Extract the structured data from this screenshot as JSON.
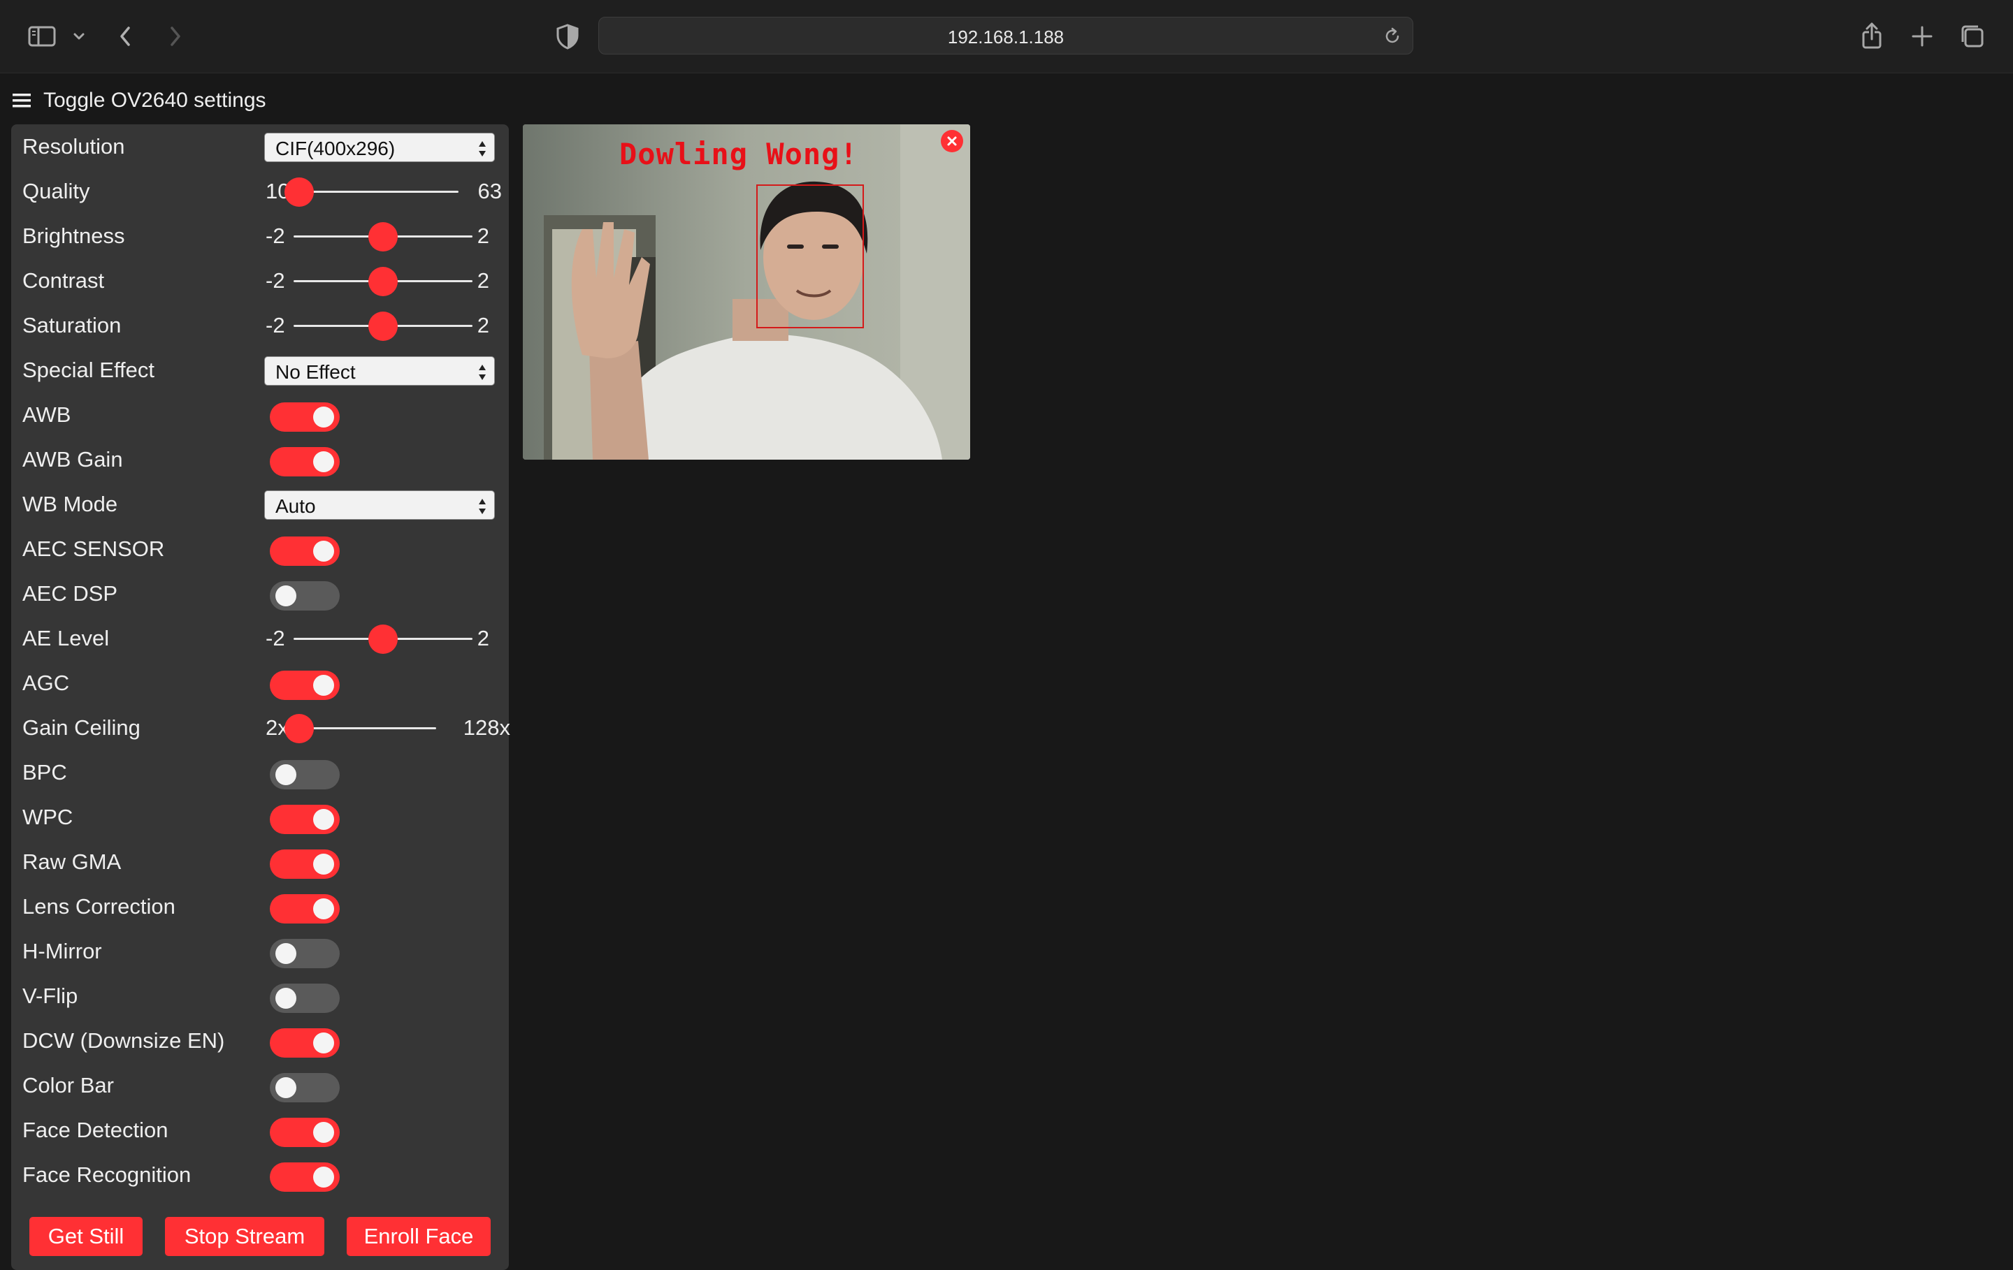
{
  "browser": {
    "url": "192.168.1.188",
    "icons": {
      "sidebar": "sidebar-icon",
      "back": "chevron-left-icon",
      "forward": "chevron-right-icon",
      "privacy": "shield-icon",
      "reload": "reload-icon",
      "share": "share-icon",
      "new_tab": "plus-icon",
      "tabs": "tab-overview-icon"
    }
  },
  "menu": {
    "toggle_label": "Toggle OV2640 settings"
  },
  "settings": {
    "resolution": {
      "label": "Resolution",
      "value": "CIF(400x296)"
    },
    "quality": {
      "label": "Quality",
      "min": "10",
      "max": "63",
      "value": 10
    },
    "brightness": {
      "label": "Brightness",
      "min": "-2",
      "max": "2",
      "value": 0
    },
    "contrast": {
      "label": "Contrast",
      "min": "-2",
      "max": "2",
      "value": 0
    },
    "saturation": {
      "label": "Saturation",
      "min": "-2",
      "max": "2",
      "value": 0
    },
    "special_effect": {
      "label": "Special Effect",
      "value": "No Effect"
    },
    "awb": {
      "label": "AWB",
      "on": true
    },
    "awb_gain": {
      "label": "AWB Gain",
      "on": true
    },
    "wb_mode": {
      "label": "WB Mode",
      "value": "Auto"
    },
    "aec_sensor": {
      "label": "AEC SENSOR",
      "on": true
    },
    "aec_dsp": {
      "label": "AEC DSP",
      "on": false
    },
    "ae_level": {
      "label": "AE Level",
      "min": "-2",
      "max": "2",
      "value": 0
    },
    "agc": {
      "label": "AGC",
      "on": true
    },
    "gain_ceiling": {
      "label": "Gain Ceiling",
      "min": "2x",
      "max": "128x",
      "value": 0
    },
    "bpc": {
      "label": "BPC",
      "on": false
    },
    "wpc": {
      "label": "WPC",
      "on": true
    },
    "raw_gma": {
      "label": "Raw GMA",
      "on": true
    },
    "lens_correction": {
      "label": "Lens Correction",
      "on": true
    },
    "h_mirror": {
      "label": "H-Mirror",
      "on": false
    },
    "v_flip": {
      "label": "V-Flip",
      "on": false
    },
    "dcw": {
      "label": "DCW (Downsize EN)",
      "on": true
    },
    "color_bar": {
      "label": "Color Bar",
      "on": false
    },
    "face_detection": {
      "label": "Face Detection",
      "on": true
    },
    "face_recognition": {
      "label": "Face Recognition",
      "on": true
    }
  },
  "buttons": {
    "get_still": "Get Still",
    "stop_stream": "Stop Stream",
    "enroll_face": "Enroll Face"
  },
  "stream": {
    "overlay_text": "Dowling Wong!",
    "close_icon": "close-icon"
  },
  "colors": {
    "accent": "#ff3034",
    "panel": "#363636",
    "background": "#181818"
  }
}
